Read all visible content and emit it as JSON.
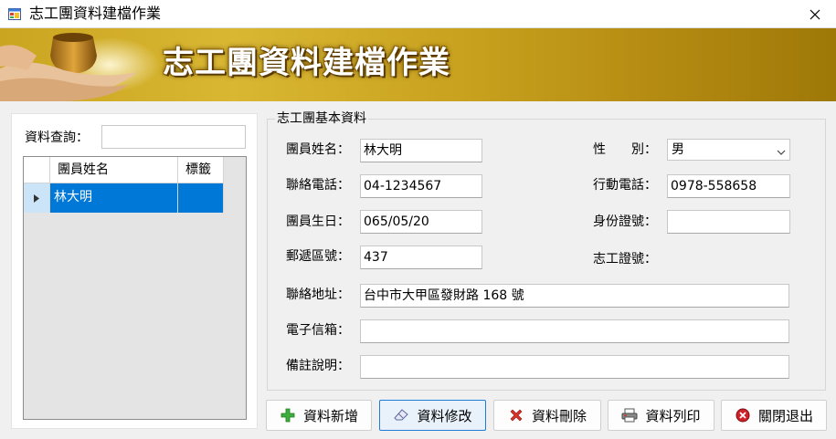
{
  "window": {
    "title": "志工團資料建檔作業"
  },
  "banner": {
    "title": "志工團資料建檔作業"
  },
  "search": {
    "label": "資料查詢：",
    "value": ""
  },
  "grid": {
    "columns": [
      "團員姓名",
      "標籤"
    ],
    "rows": [
      {
        "name": "林大明",
        "tag": "",
        "selected": true
      }
    ]
  },
  "group": {
    "title": "志工團基本資料"
  },
  "form": {
    "name": {
      "label": "團員姓名：",
      "value": "林大明"
    },
    "gender": {
      "label": "性　　別：",
      "value": "男"
    },
    "tel": {
      "label": "聯絡電話：",
      "value": "04-1234567"
    },
    "mobile": {
      "label": "行動電話：",
      "value": "0978-558658"
    },
    "birthday": {
      "label": "團員生日：",
      "value": "065/05/20"
    },
    "id_no": {
      "label": "身份證號：",
      "value": ""
    },
    "zip": {
      "label": "郵遞區號：",
      "value": "437"
    },
    "vol_no": {
      "label": "志工證號：",
      "value": ""
    },
    "address": {
      "label": "聯絡地址：",
      "value": "台中市大甲區發財路 168 號"
    },
    "email": {
      "label": "電子信箱：",
      "value": ""
    },
    "note": {
      "label": "備註說明：",
      "value": ""
    }
  },
  "buttons": {
    "add": "資料新增",
    "edit": "資料修改",
    "delete": "資料刪除",
    "print": "資料列印",
    "exit": "關閉退出"
  },
  "colors": {
    "banner": "#c9a21f",
    "selection": "#0078d7",
    "focus": "#1e7cd6"
  }
}
